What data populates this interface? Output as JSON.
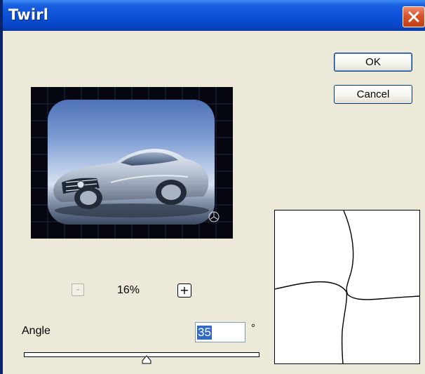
{
  "window": {
    "title": "Twirl"
  },
  "buttons": {
    "ok_label": "OK",
    "cancel_label": "Cancel"
  },
  "preview": {
    "image_description": "silver sports car on blue sky background",
    "emblem_icon": "three-pointed-star-emblem"
  },
  "zoom": {
    "minus_label": "-",
    "level": "16%",
    "plus_label": "+"
  },
  "angle": {
    "label": "Angle",
    "value": "35",
    "unit": "°"
  },
  "colors": {
    "titlebar": "#0a4fd6",
    "dialog_bg": "#ece9d8",
    "close_button": "#d9532d",
    "selection": "#316ac5"
  },
  "icons": {
    "close": "close-x-icon",
    "slider_thumb": "triangle-thumb-icon"
  }
}
